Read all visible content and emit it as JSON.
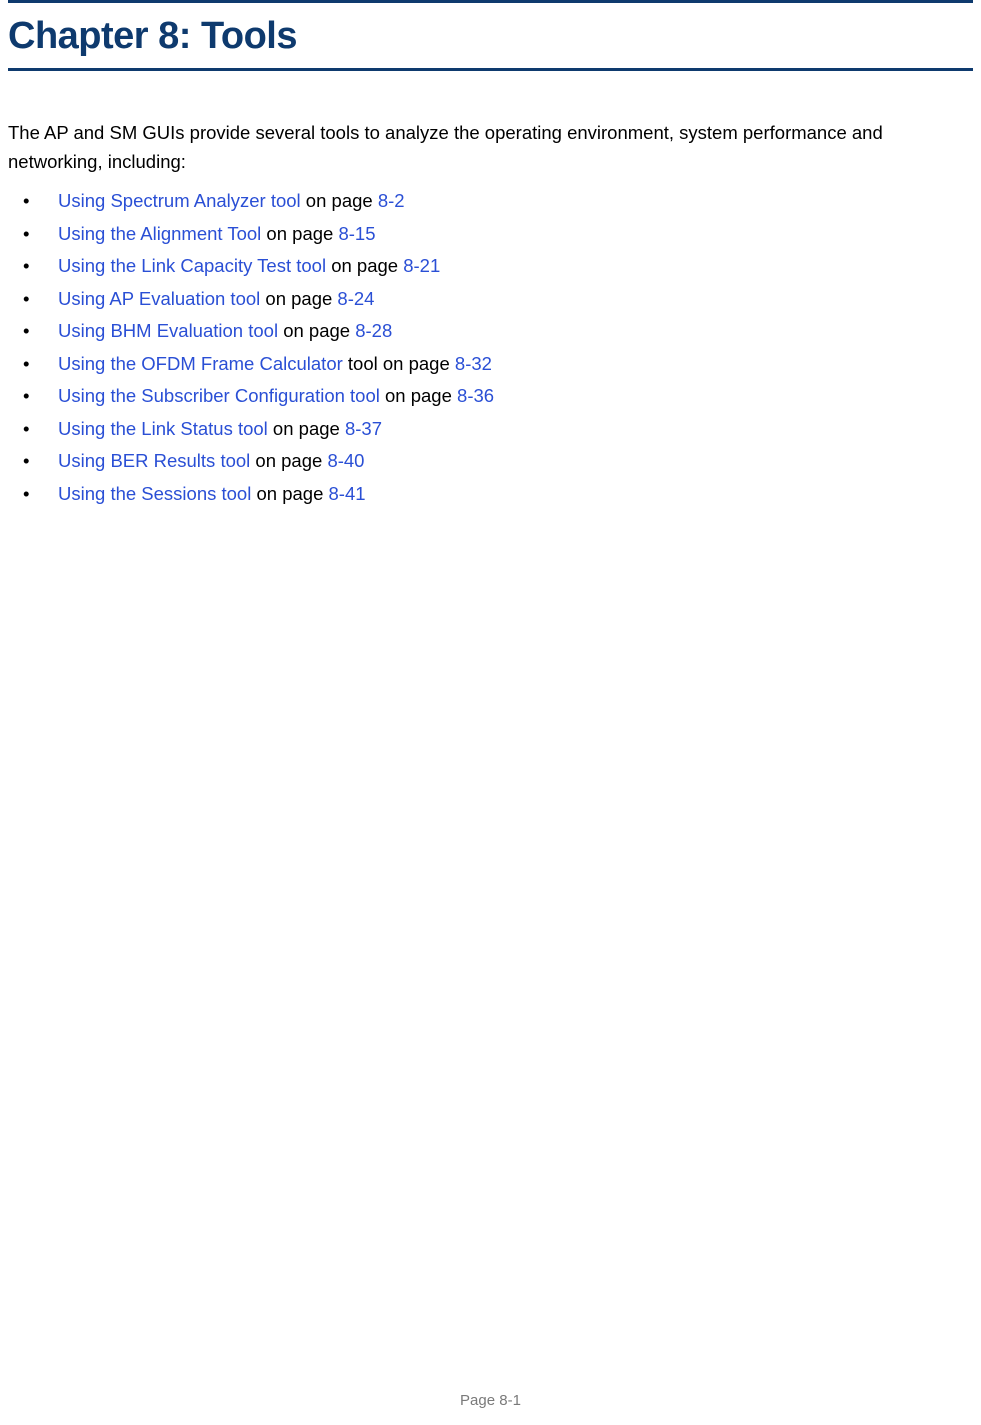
{
  "chapter": {
    "title": "Chapter 8:  Tools"
  },
  "intro": "The AP and SM GUIs provide several tools to analyze the operating environment, system performance and networking, including:",
  "items": [
    {
      "link": "Using Spectrum Analyzer tool",
      "mid": " on page ",
      "page": "8-2"
    },
    {
      "link": "Using the Alignment Tool",
      "mid": " on page ",
      "page": "8-15"
    },
    {
      "link": "Using the Link Capacity Test tool",
      "mid": " on page ",
      "page": "8-21"
    },
    {
      "link": "Using AP Evaluation tool",
      "mid": " on page ",
      "page": "8-24"
    },
    {
      "link": "Using BHM Evaluation tool",
      "mid": " on page ",
      "page": "8-28"
    },
    {
      "link": "Using the OFDM Frame Calculator",
      "mid": " tool on page ",
      "page": "8-32"
    },
    {
      "link": "Using the Subscriber Configuration tool",
      "mid": " on page ",
      "page": "8-36"
    },
    {
      "link": "Using the Link Status tool",
      "mid": " on page ",
      "page": "8-37"
    },
    {
      "link": "Using BER Results tool",
      "mid": " on page ",
      "page": "8-40"
    },
    {
      "link": "Using the Sessions tool",
      "mid": " on page ",
      "page": "8-41"
    }
  ],
  "footer": {
    "page_label": "Page 8-1"
  }
}
